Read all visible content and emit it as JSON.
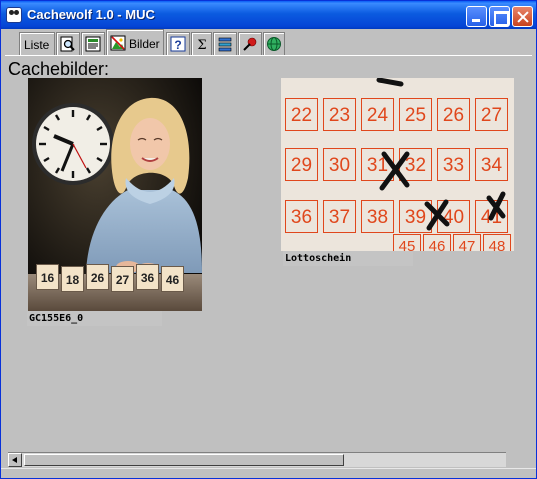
{
  "window": {
    "title": "Cachewolf 1.0 - MUC"
  },
  "tabs": [
    {
      "label": "Liste",
      "icon": "list-text"
    },
    {
      "label": "",
      "icon": "magnifier-page-icon"
    },
    {
      "label": "",
      "icon": "text-page-icon"
    },
    {
      "label": "Bilder",
      "icon": "picture-icon",
      "selected": true
    },
    {
      "label": "",
      "icon": "help-icon"
    },
    {
      "label": "",
      "icon": "sigma-icon"
    },
    {
      "label": "",
      "icon": "gps-device-icon"
    },
    {
      "label": "",
      "icon": "pushpin-icon"
    },
    {
      "label": "",
      "icon": "globe-icon"
    }
  ],
  "content": {
    "heading": "Cachebilder:",
    "images": [
      {
        "caption": "GC155E6_0",
        "depicts": "lottery-presenter-photo"
      },
      {
        "caption": "Lottoschein",
        "depicts": "lottery-ticket-photo"
      }
    ]
  },
  "lottery_photo": {
    "balls": [
      "16",
      "18",
      "26",
      "27",
      "36",
      "46"
    ]
  },
  "ticket_photo": {
    "numbers": [
      "22",
      "23",
      "24",
      "25",
      "26",
      "27",
      "29",
      "30",
      "31",
      "32",
      "33",
      "34",
      "36",
      "37",
      "38",
      "39",
      "40",
      "41",
      "45",
      "46",
      "47",
      "48"
    ]
  },
  "colors": {
    "titlebar": "#0b5be0",
    "window_bg": "#c0c0c0",
    "ticket_ink": "#e0471c"
  }
}
